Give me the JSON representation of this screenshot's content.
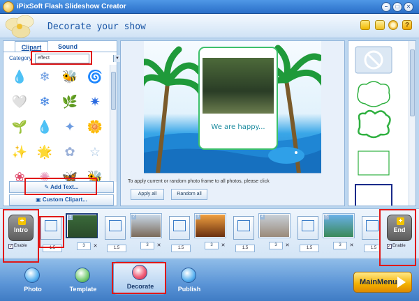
{
  "window": {
    "title": "iPixSoft Flash Slideshow Creator"
  },
  "header": {
    "title": "Decorate your show",
    "help_glyph": "?"
  },
  "left_panel": {
    "tabs": [
      "Clipart",
      "Sound"
    ],
    "category_label": "Category",
    "category_value": "effect",
    "clips": [
      "💧",
      "❄",
      "🐝",
      "🌀",
      "🤍",
      "❄",
      "🌿",
      "✷",
      "🌱",
      "💧",
      "✦",
      "🌼",
      "✨",
      "🌟",
      "✿",
      "☆",
      "❀",
      "✺",
      "🦋",
      "🐝"
    ],
    "add_text_label": "Add Text...",
    "custom_clipart_label": "Custom Clipart..."
  },
  "preview": {
    "caption": "We are happy...",
    "tip": "To apply current or random photo frame  to all photos, please click",
    "apply_all_label": "Apply all",
    "random_all_label": "Random all"
  },
  "timeline": {
    "intro_label": "Intro",
    "end_label": "End",
    "enable_label": "Enable",
    "transitions": [
      "1.5",
      "1.5",
      "1.5",
      "1.5",
      "1.5",
      "1.5"
    ],
    "photo_duration": "3",
    "photo_numbers": [
      "1",
      "2",
      "3",
      "4",
      "5"
    ],
    "remove_glyph": "✕"
  },
  "bottom_nav": {
    "items": [
      "Photo",
      "Template",
      "Decorate",
      "Publish"
    ],
    "main_menu_label": "MainMenu"
  }
}
